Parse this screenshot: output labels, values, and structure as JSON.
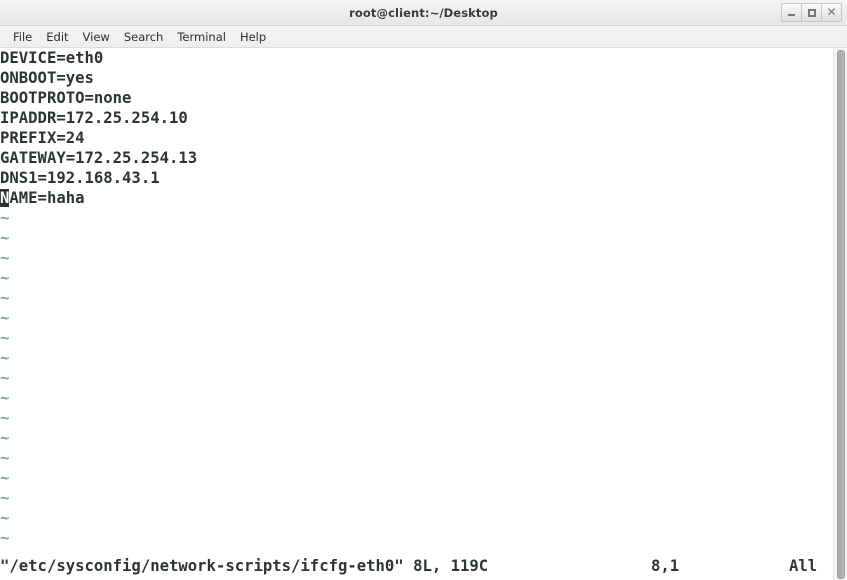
{
  "window": {
    "title": "root@client:~/Desktop",
    "controls": [
      {
        "name": "minimize-button",
        "label": "_"
      },
      {
        "name": "maximize-button",
        "label": "□"
      },
      {
        "name": "close-button",
        "label": "×"
      }
    ]
  },
  "menubar": {
    "items": [
      {
        "label": "File"
      },
      {
        "label": "Edit"
      },
      {
        "label": "View"
      },
      {
        "label": "Search"
      },
      {
        "label": "Terminal"
      },
      {
        "label": "Help"
      }
    ]
  },
  "editor": {
    "cursor_char": "N",
    "lines": [
      "DEVICE=eth0",
      "ONBOOT=yes",
      "BOOTPROTO=none",
      "IPADDR=172.25.254.10",
      "PREFIX=24",
      "GATEWAY=172.25.254.13",
      "DNS1=192.168.43.1"
    ],
    "cursor_line_rest": "AME=haha",
    "empty_marker": "~",
    "empty_marker_count": 17
  },
  "statusline": {
    "file_info": "\"/etc/sysconfig/network-scripts/ifcfg-eth0\" 8L, 119C",
    "position": "8,1",
    "scroll": "All"
  },
  "colors": {
    "terminal_background": "#ffffff",
    "terminal_foreground": "#2e3436",
    "tilde_blue": "#7b9fd6",
    "titlebar": "#eeeeee",
    "scrollbar_thumb": "#a8a8a8"
  }
}
